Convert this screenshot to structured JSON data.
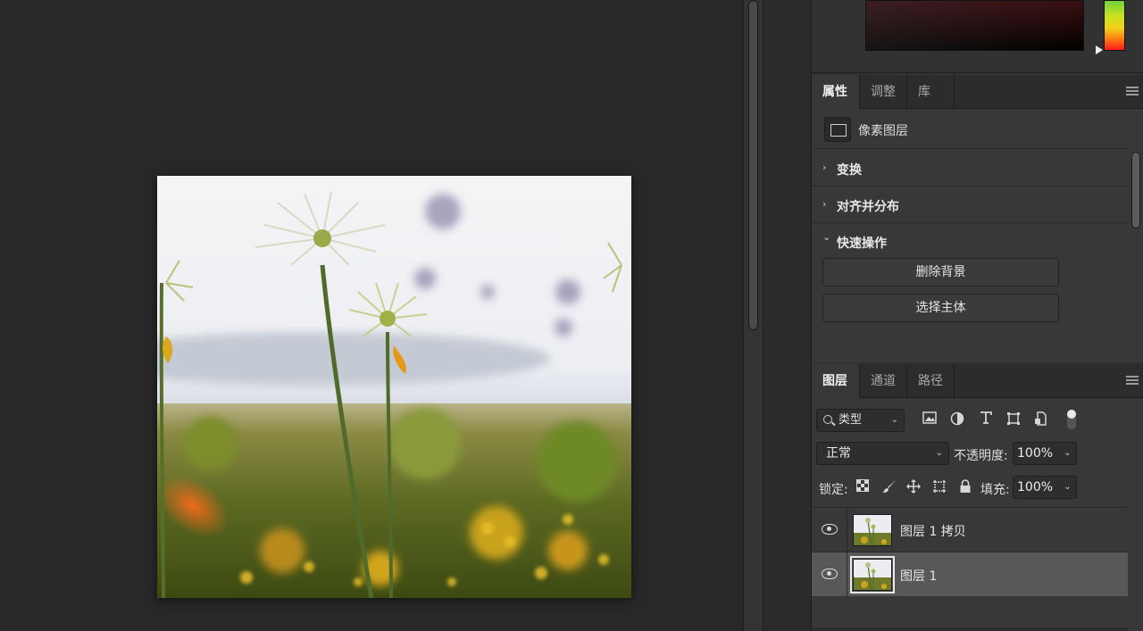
{
  "properties_panel": {
    "tabs": [
      {
        "label": "属性",
        "active": true
      },
      {
        "label": "调整",
        "active": false
      },
      {
        "label": "库",
        "active": false
      }
    ],
    "layer_kind": "像素图层",
    "sections": [
      {
        "label": "变换",
        "expanded": false
      },
      {
        "label": "对齐并分布",
        "expanded": false
      },
      {
        "label": "快速操作",
        "expanded": true
      }
    ],
    "quick_actions": {
      "remove_background": "删除背景",
      "select_subject": "选择主体"
    }
  },
  "layers_panel": {
    "tabs": [
      {
        "label": "图层",
        "active": true
      },
      {
        "label": "通道",
        "active": false
      },
      {
        "label": "路径",
        "active": false
      }
    ],
    "filter_kind": "类型",
    "blend_mode": "正常",
    "opacity_label": "不透明度:",
    "opacity_value": "100%",
    "lock_label": "锁定:",
    "fill_label": "填充:",
    "fill_value": "100%",
    "layers": [
      {
        "name": "图层 1 拷贝",
        "visible": true,
        "selected": false
      },
      {
        "name": "图层 1",
        "visible": true,
        "selected": true
      }
    ]
  },
  "icons": {
    "chevron_right": "›",
    "chevron_down": "⌄",
    "dropdown": "⌄",
    "filter_icons": [
      "image-filter-icon",
      "adjustment-filter-icon",
      "type-filter-icon",
      "shape-filter-icon",
      "smart-object-filter-icon"
    ],
    "lock_icons": [
      "lock-transparent-pixels-icon",
      "lock-image-pixels-icon",
      "lock-position-icon",
      "lock-artboard-icon",
      "lock-all-icon"
    ]
  },
  "colors": {
    "panel_bg": "#383838",
    "canvas_bg": "#282828",
    "selected_layer": "#585858",
    "hue_strip_bottom": "#ff1a1a"
  }
}
